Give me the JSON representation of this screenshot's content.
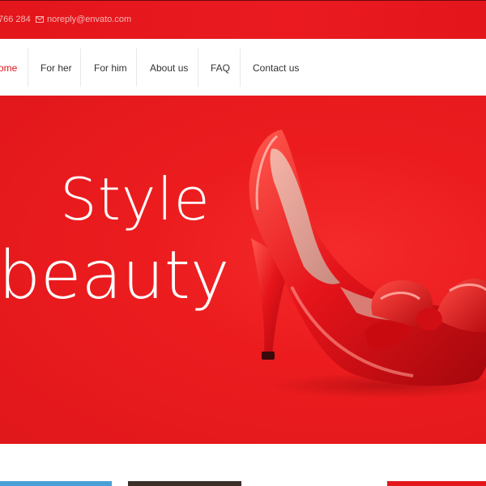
{
  "topbar": {
    "phone": "766 284",
    "email": "noreply@envato.com"
  },
  "nav": {
    "items": [
      {
        "label": "ome",
        "active": true
      },
      {
        "label": "For her",
        "active": false
      },
      {
        "label": "For him",
        "active": false
      },
      {
        "label": "About us",
        "active": false
      },
      {
        "label": "FAQ",
        "active": false
      },
      {
        "label": "Contact us",
        "active": false
      }
    ]
  },
  "hero": {
    "line1": "Style",
    "line2": "beauty",
    "image": "red-high-heel-shoe-with-bow"
  },
  "colors": {
    "brand_red": "#e3161c",
    "nav_active": "#e0151c",
    "nav_text": "#333333"
  }
}
